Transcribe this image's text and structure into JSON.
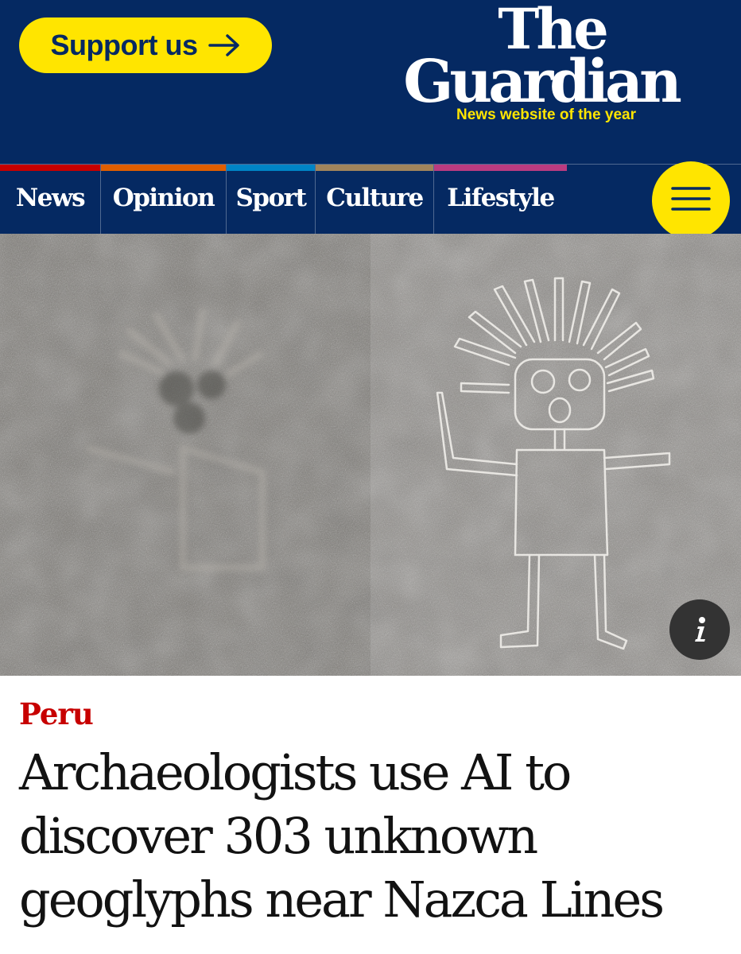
{
  "header": {
    "support_label": "Support us",
    "logo_line1": "The",
    "logo_line2": "Guardian",
    "tagline": "News website of the year"
  },
  "nav": {
    "items": [
      {
        "label": "News",
        "color": "#c70000"
      },
      {
        "label": "Opinion",
        "color": "#e05e00"
      },
      {
        "label": "Sport",
        "color": "#0084c6"
      },
      {
        "label": "Culture",
        "color": "#a1845c"
      },
      {
        "label": "Lifestyle",
        "color": "#bb3b80"
      }
    ],
    "menu_icon": "hamburger-menu-icon"
  },
  "hero": {
    "info_label": "i",
    "icons": [
      "info-icon"
    ]
  },
  "article": {
    "kicker": "Peru",
    "headline": "Archaeologists use AI to discover 303 unknown geoglyphs near Nazca Lines"
  },
  "colors": {
    "brand_blue": "#052962",
    "brand_yellow": "#ffe500",
    "kicker_red": "#c70000"
  }
}
